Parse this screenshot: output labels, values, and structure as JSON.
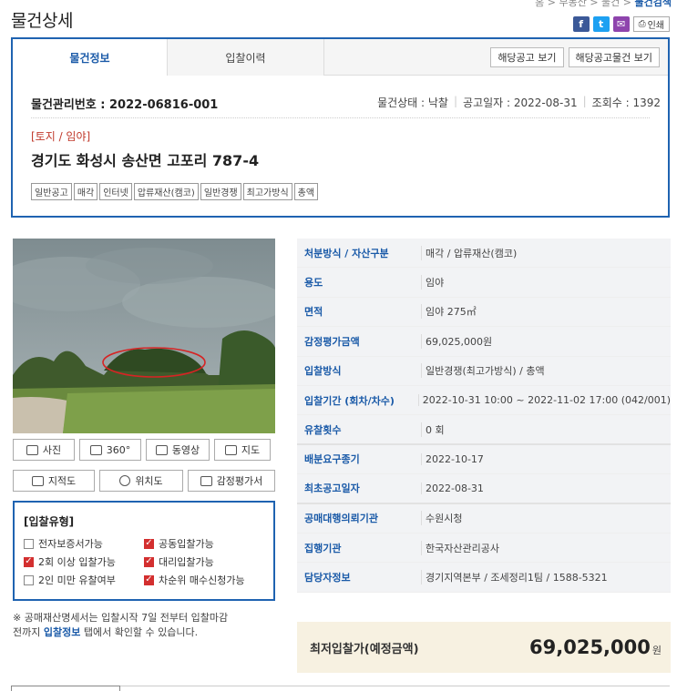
{
  "page": {
    "title": "물건상세",
    "breadcrumb": {
      "path": "홈 > 부동산 > 물건 > ",
      "current": "물건검색"
    }
  },
  "share": {
    "facebook": "f",
    "twitter": "t",
    "mail": "✉",
    "print": "인쇄"
  },
  "tabs": [
    {
      "label": "물건정보",
      "active": true
    },
    {
      "label": "입찰이력",
      "active": false
    }
  ],
  "notice_buttons": {
    "notice": "해당공고 보기",
    "notice_items": "해당공고물건 보기"
  },
  "summary": {
    "mgmt_number": "물건관리번호 : 2022-06816-001",
    "status": "물건상태 : 낙찰",
    "notice_date": "공고일자 : 2022-08-31",
    "views": "조회수 : 1392",
    "category": "[토지 / 임야]",
    "address": "경기도 화성시 송산면 고포리 787-4",
    "tags": [
      "일반공고",
      "매각",
      "인터넷",
      "압류재산(캠코)",
      "일반경쟁",
      "최고가방식",
      "총액"
    ]
  },
  "media_buttons": {
    "photo": "사진",
    "view360": "360°",
    "video": "동영상",
    "map": "지도",
    "cadastral": "지적도",
    "location": "위치도",
    "appraisal": "감정평가서"
  },
  "bid_type": {
    "title": "[입찰유형]",
    "options": [
      {
        "label": "전자보증서가능",
        "checked": false
      },
      {
        "label": "공동입찰가능",
        "checked": true
      },
      {
        "label": "2회 이상 입찰가능",
        "checked": true
      },
      {
        "label": "대리입찰가능",
        "checked": true
      },
      {
        "label": "2인 미만 유찰여부",
        "checked": false
      },
      {
        "label": "차순위 매수신청가능",
        "checked": true
      }
    ]
  },
  "note": {
    "text1": "※ 공매재산명세서는 입찰시작 7일 전부터 입찰마감",
    "text2_pre": "전까지 ",
    "text2_link": "입찰정보",
    "text2_post": " 탭에서 확인할 수 있습니다."
  },
  "details": [
    {
      "label": "처분방식 / 자산구분",
      "value": "매각 / 압류재산(캠코)"
    },
    {
      "label": "용도",
      "value": "임야"
    },
    {
      "label": "면적",
      "value": "임야 275㎡"
    },
    {
      "label": "감정평가금액",
      "value": "69,025,000원"
    },
    {
      "label": "입찰방식",
      "value": "일반경쟁(최고가방식) / 총액"
    },
    {
      "label": "입찰기간 (회차/차수)",
      "value": "2022-10-31 10:00 ~ 2022-11-02 17:00 (042/001)"
    },
    {
      "label": "유찰횟수",
      "value": "0 회"
    },
    {
      "label": "배분요구종기",
      "value": "2022-10-17"
    },
    {
      "label": "최초공고일자",
      "value": "2022-08-31"
    },
    {
      "label": "공매대행의뢰기관",
      "value": "수원시청"
    },
    {
      "label": "집행기관",
      "value": "한국자산관리공사"
    },
    {
      "label": "담당자정보",
      "value": "경기지역본부 / 조세정리1팀 / 1588-5321"
    }
  ],
  "price": {
    "label": "최저입찰가(예정금액)",
    "value": "69,025,000",
    "unit": "원"
  },
  "colors": {
    "accent": "#1f63b1",
    "label_blue": "#1a5aa8",
    "check_red": "#d32f2f",
    "price_bg": "#f7f1e1"
  }
}
